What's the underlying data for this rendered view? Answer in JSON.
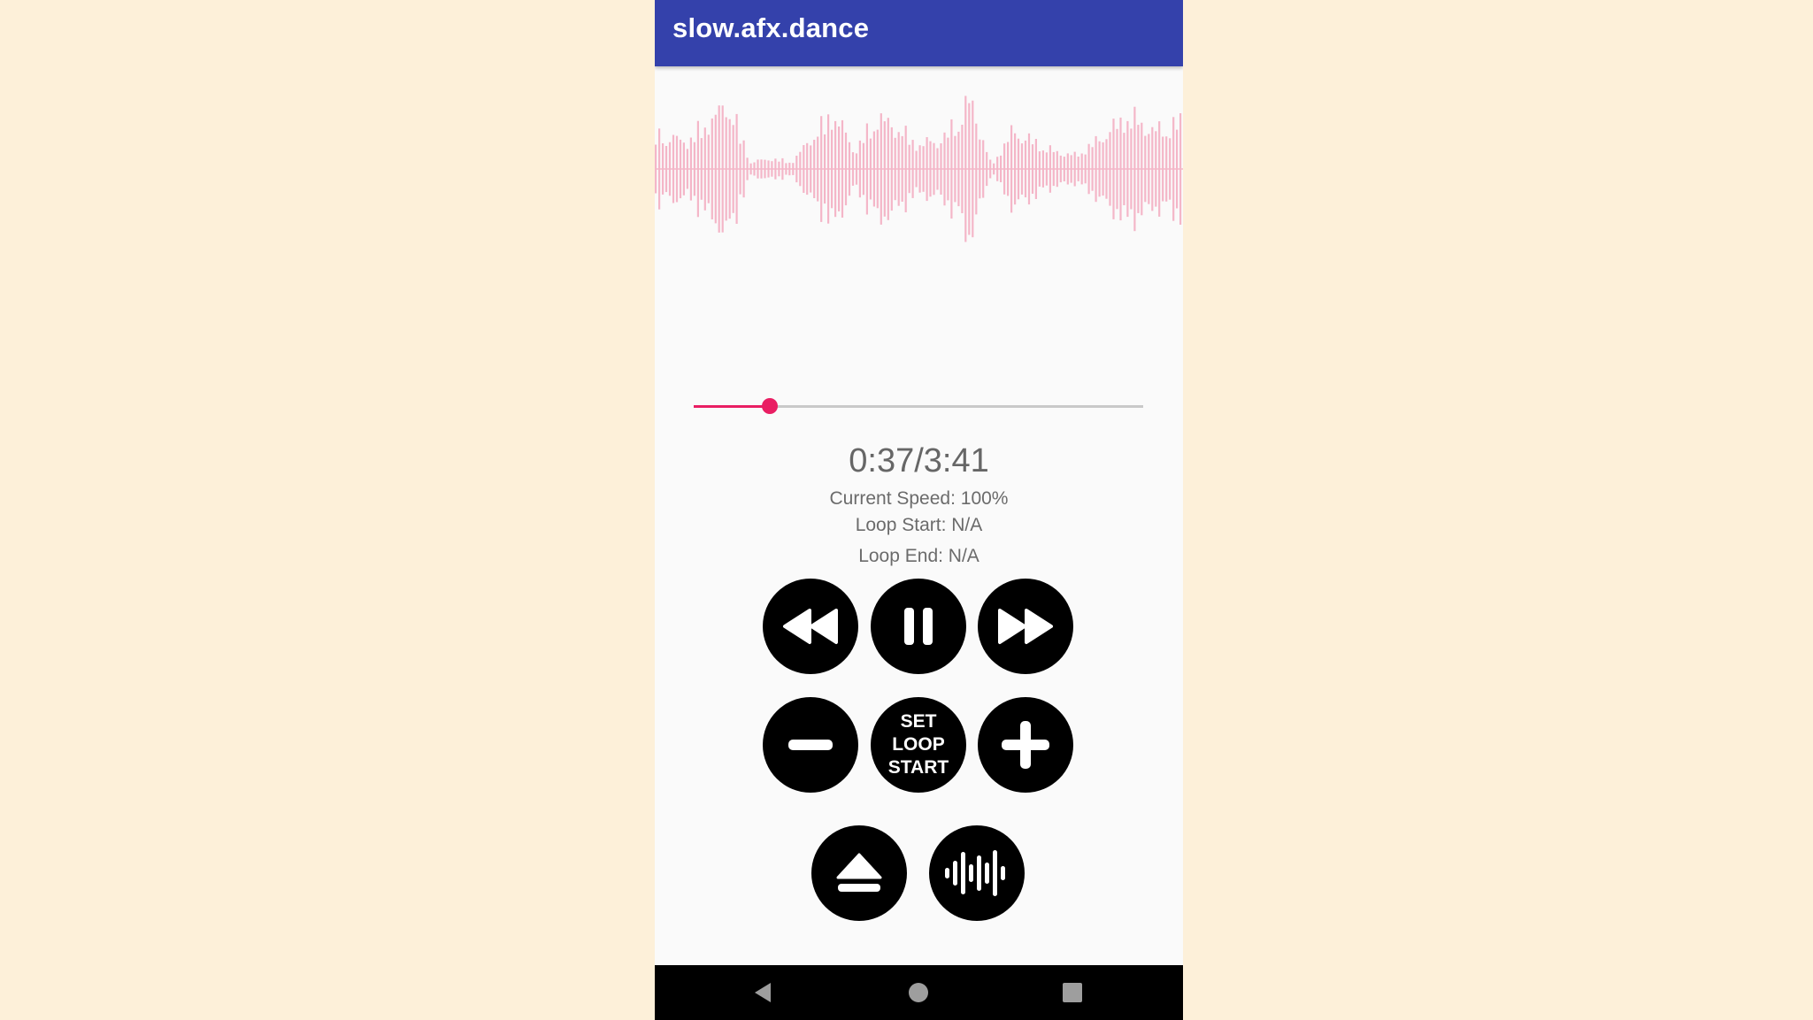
{
  "app": {
    "title": "slow.afx.dance"
  },
  "waveform": {
    "color": "#f4b6c8",
    "icon": "waveform-display"
  },
  "seekbar": {
    "progress": 0.17,
    "fill_color": "#e91e63",
    "track_color": "#c9c9c9"
  },
  "status": {
    "time": "0:37/3:41",
    "speed": "Current Speed: 100%",
    "loop_start": "Loop Start: N/A",
    "loop_end": "Loop End: N/A"
  },
  "controls": {
    "rewind_icon": "rewind-icon",
    "pause_icon": "pause-icon",
    "fast_forward_icon": "fast-forward-icon",
    "speed_down_icon": "minus-icon",
    "set_loop_label_line1": "SET LOOP",
    "set_loop_label_line2": "START",
    "speed_up_icon": "plus-icon",
    "eject_icon": "eject-icon",
    "waveform_toggle_icon": "waveform-icon"
  },
  "nav": {
    "back_icon": "back-triangle-icon",
    "home_icon": "home-circle-icon",
    "recents_icon": "recents-square-icon"
  },
  "colors": {
    "app_bar": "#3441ab",
    "background": "#fdf0d9",
    "accent": "#e91e63"
  }
}
